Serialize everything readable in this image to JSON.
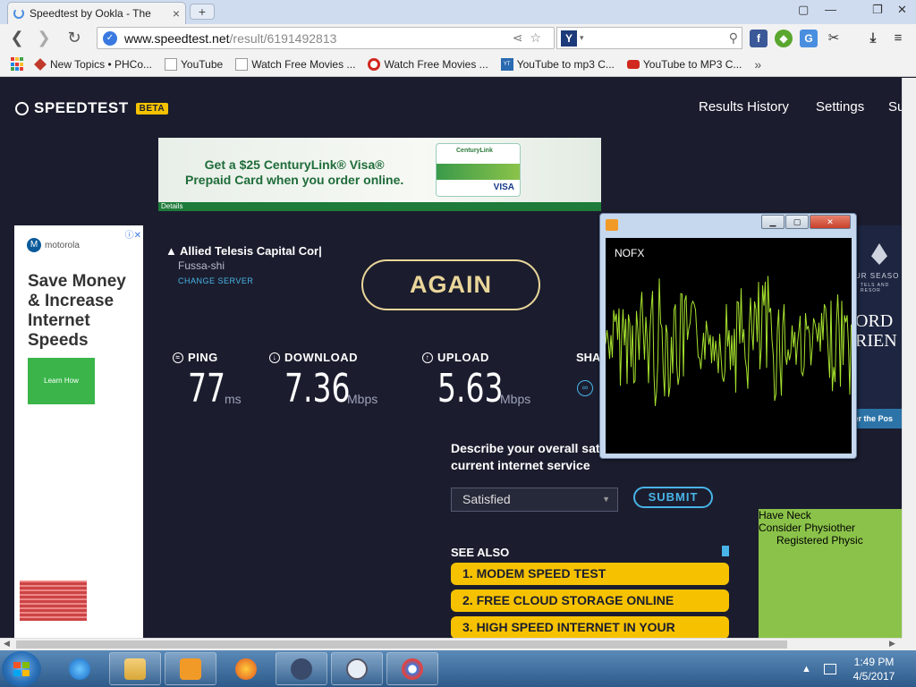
{
  "browser": {
    "tab_title": "Speedtest by Ookla - The",
    "tab_close": "×",
    "new_tab": "+",
    "url_host": "www.speedtest.net",
    "url_path": "/result/6191492813",
    "window_controls": [
      "▢",
      "—",
      "❐",
      "✕"
    ],
    "bookmarks": [
      {
        "label": "New Topics • PHCo...",
        "icon": "gem-icon",
        "color": "#c0392b"
      },
      {
        "label": "YouTube",
        "icon": "page-icon",
        "color": "#999999"
      },
      {
        "label": "Watch Free Movies ...",
        "icon": "page-icon",
        "color": "#999999"
      },
      {
        "label": "Watch Free Movies ...",
        "icon": "target-icon",
        "color": "#d0281e"
      },
      {
        "label": "YouTube to mp3 C...",
        "icon": "ytmp3-icon",
        "color": "#2a6ab0"
      },
      {
        "label": "YouTube to MP3 C...",
        "icon": "youtube-icon",
        "color": "#d0281e"
      }
    ],
    "bookmarks_more": "»"
  },
  "site": {
    "logo": "SPEEDTEST",
    "beta": "BETA",
    "nav": [
      "Results History",
      "Settings",
      "Su"
    ]
  },
  "ad_top": {
    "line1": "Get a $25 CenturyLink® Visa®",
    "line2": "Prepaid Card when you order online.",
    "card_brand": "CenturyLink",
    "card_visa": "VISA",
    "details": "Details"
  },
  "ad_left": {
    "brand": "motorola",
    "headline": "Save Money & Increase Internet Speeds",
    "cta": "Learn How",
    "close": "ⓘ✕"
  },
  "server": {
    "name": "Allied Telesis Capital Cor|",
    "location": "Fussa-shi",
    "change": "CHANGE SERVER"
  },
  "again_label": "AGAIN",
  "metrics": {
    "ping": {
      "label": "PING",
      "value": "77",
      "unit": "ms"
    },
    "download": {
      "label": "DOWNLOAD",
      "value": "7.36",
      "unit": "Mbps"
    },
    "upload": {
      "label": "UPLOAD",
      "value": "5.63",
      "unit": "Mbps"
    },
    "share_label": "SHA"
  },
  "survey": {
    "question": "Describe your overall satisfaction with your current internet service",
    "selected": "Satisfied",
    "submit": "SUBMIT"
  },
  "see_also": {
    "title": "SEE ALSO",
    "items": [
      "1.  MODEM SPEED TEST",
      "2.  FREE CLOUD STORAGE ONLINE",
      "3.  HIGH SPEED INTERNET IN YOUR"
    ]
  },
  "ad_right_top": {
    "brand": "UR SEASO",
    "brand_sub": "TELS AND RESOR",
    "line1": "ORD",
    "line2": "RIEN",
    "strip": "Discover the Pos"
  },
  "ad_right_bottom": {
    "title": "Have Neck",
    "line1": "Consider Physiother",
    "line2": "Registered Physic"
  },
  "visualizer": {
    "track": "NOFX",
    "buttons": [
      "▁",
      "▢",
      "✕"
    ]
  },
  "taskbar": {
    "time": "1:49 PM",
    "date": "4/5/2017",
    "tray_arrow": "▲"
  },
  "colors": {
    "page_bg": "#1b1d2e",
    "accent_yellow": "#f6c200",
    "accent_blue": "#48b4e8",
    "again_gold": "#ead69a",
    "waveform": "#a6e22e"
  }
}
